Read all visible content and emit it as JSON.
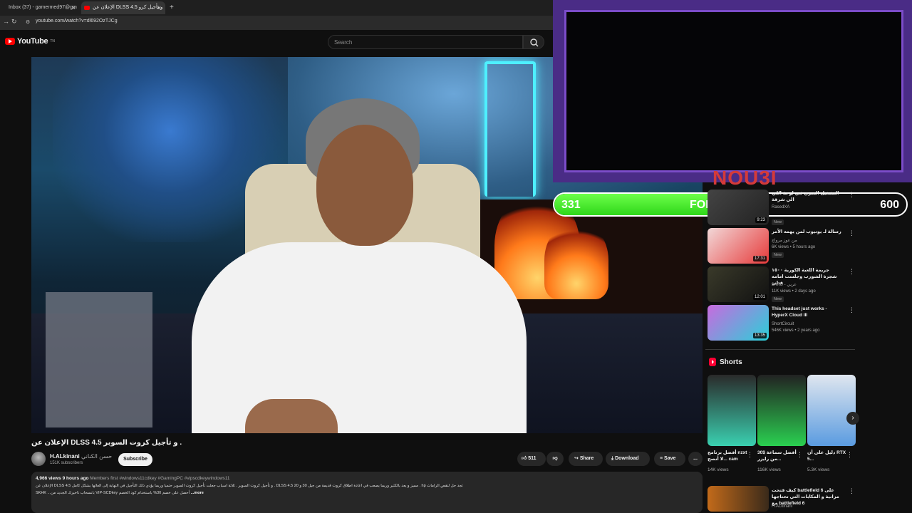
{
  "browser": {
    "tabs": [
      {
        "label": "Inbox (37) - gamermed97@gm"
      },
      {
        "label": "الإعلان عن DLSS 4.5 و تأجيل كرو"
      }
    ],
    "new_tab": "+",
    "url": "youtube.com/watch?v=dl692OzTJCg"
  },
  "header": {
    "logo_text": "YouTube",
    "logo_sup": "TN",
    "search_placeholder": "Search"
  },
  "overlay": {
    "streamer_name": "NOU3I",
    "followers_current": "331",
    "followers_label": "FOLLOWERS",
    "followers_goal": "600",
    "followers_progress": 0.55
  },
  "video": {
    "title": "الإعلان عن DLSS 4.5 و تأجيل كروت السوبر .",
    "channel": "H.ALkinani",
    "channel_arabic": "حسن الكناني",
    "subscribers": "151K subscribers",
    "subscribe_label": "Subscribe",
    "likes": "511",
    "share_label": "Share",
    "download_label": "Download",
    "save_label": "Save",
    "more_label": "...",
    "views": "4,966 views",
    "published": "9 hours ago",
    "members_first": "Members first",
    "hashtags": "#windows11cdkey #GamingPC #vipscdkeywindows11",
    "desc_line1": "الإعلان عن DLSS 4.5 و تأجيل كروت السوبر . ثلاثة اسباب جعلت تأجيل كروت السوبر حتميا وربما يؤدي ذلك التأجيل في النهاية إلى الغائها بشكل كامل . DLSS 4.5 مميز و يعد بالكثير وربما يصعب في اعادة اطلاق كروت قديمة من جيل 30 و 20 . hp تجد حل لنقص الرامات",
    "desc_line2": "SKHK ...بانسحاب تاخيرك الجديد من VIP-SCDkey أحصل على خصم 30% باستخدام كود الخصم",
    "desc_more": "...more"
  },
  "sidebar": {
    "recs": [
      {
        "title": "التشغيل السري في لوحة اللي الي شرقة",
        "channel": "RasedXA",
        "meta": "",
        "badge": "New",
        "duration": "9:23"
      },
      {
        "title": "رسالة لـ يوتيوب لمن يهمه الأمر",
        "channel": "من عوز مرواج",
        "meta": "6K views • 5 hours ago",
        "badge": "New",
        "duration": "17:31"
      },
      {
        "title": "جريمة اللعبة الكورية ١٥٠٠ شجرة الشورب وجلست امامه قتلى",
        "channel": "3ARU - عربي",
        "meta": "11K views • 2 days ago",
        "badge": "New",
        "duration": "12:01"
      },
      {
        "title": "This headset just works - HyperX Cloud III",
        "channel": "ShortCircuit",
        "meta": "546K views • 2 years ago",
        "badge": "",
        "duration": "13:35"
      }
    ],
    "shorts_header": "Shorts",
    "shorts": [
      {
        "title": "أفضل برنامج nzxt لا أنصح... cam",
        "views": "14K views"
      },
      {
        "title": "أفضل سماعة $30 من رايزر...",
        "views": "116K views"
      },
      {
        "title": "دليل على أن RTX 5...",
        "views": "5.3K views"
      }
    ],
    "bottom_rec": {
      "title": "كيف فتحت battlefield 6 على مزانية و المكابات التي تحتاجها مع battlefield 6",
      "channel": "H.ALkinani"
    }
  }
}
